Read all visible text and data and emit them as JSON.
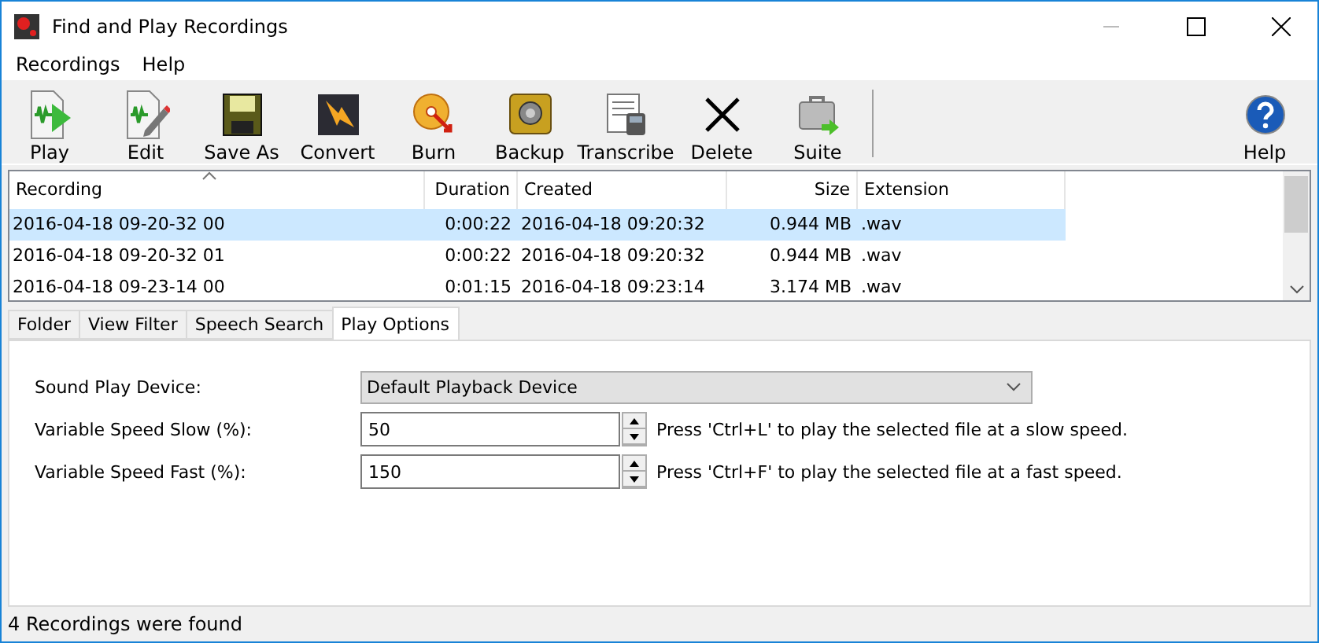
{
  "window": {
    "title": "Find and Play Recordings"
  },
  "menu": [
    "Recordings",
    "Help"
  ],
  "toolbar": [
    "Play",
    "Edit",
    "Save As",
    "Convert",
    "Burn",
    "Backup",
    "Transcribe",
    "Delete",
    "Suite"
  ],
  "help_button": "Help",
  "table": {
    "columns": [
      "Recording",
      "Duration",
      "Created",
      "Size",
      "Extension"
    ],
    "rows": [
      {
        "cells": [
          "2016-04-18 09-20-32 00",
          "0:00:22",
          "2016-04-18 09:20:32",
          "0.944 MB",
          ".wav"
        ],
        "selected": true
      },
      {
        "cells": [
          "2016-04-18 09-20-32 01",
          "0:00:22",
          "2016-04-18 09:20:32",
          "0.944 MB",
          ".wav"
        ],
        "selected": false
      },
      {
        "cells": [
          "2016-04-18 09-23-14 00",
          "0:01:15",
          "2016-04-18 09:23:14",
          "3.174 MB",
          ".wav"
        ],
        "selected": false
      }
    ]
  },
  "tabs": [
    {
      "label": "Folder",
      "selected": false
    },
    {
      "label": "View Filter",
      "selected": false
    },
    {
      "label": "Speech Search",
      "selected": false
    },
    {
      "label": "Play Options",
      "selected": true
    }
  ],
  "options": [
    {
      "kind": "dropdown",
      "label": "Sound Play Device:",
      "value": "Default Playback Device"
    },
    {
      "kind": "spin",
      "label": "Variable Speed Slow (%):",
      "value": "50",
      "hint": "Press 'Ctrl+L' to play the selected file at a slow speed."
    },
    {
      "kind": "spin",
      "label": "Variable Speed Fast (%):",
      "value": "150",
      "hint": "Press 'Ctrl+F' to play the selected file at a fast speed."
    }
  ],
  "status_bar": "4 Recordings were found"
}
